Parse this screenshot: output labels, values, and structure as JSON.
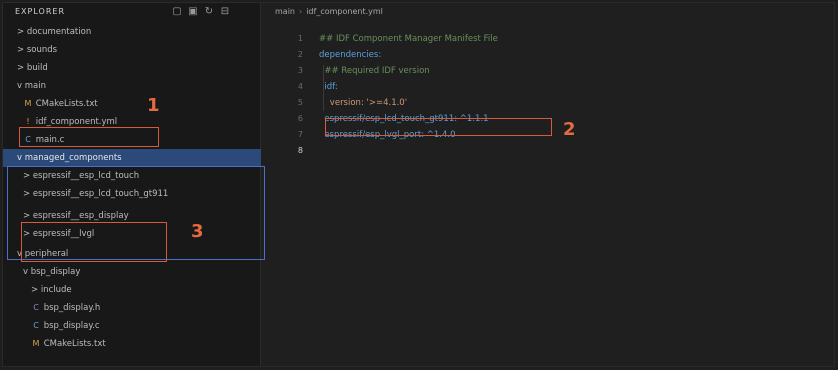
{
  "sidebar": {
    "title": "EXPLORER",
    "actions": [
      "new-file-icon",
      "new-folder-icon",
      "refresh-icon",
      "collapse-icon"
    ],
    "items": [
      {
        "label": "> documentation",
        "type": "folder"
      },
      {
        "label": "> sounds",
        "type": "folder"
      },
      {
        "label": "> build",
        "type": "folder"
      },
      {
        "label": "v main",
        "type": "folder"
      },
      {
        "label": "CMakeLists.txt",
        "type": "file"
      },
      {
        "label": "idf_component.yml",
        "type": "file"
      },
      {
        "label": "main.c",
        "type": "file"
      },
      {
        "label": "v managed_components",
        "type": "folder"
      },
      {
        "label": "> espressif__esp_lcd_touch",
        "type": "folder"
      },
      {
        "label": "> espressif__esp_lcd_touch_gt911",
        "type": "folder"
      },
      {
        "label": "> espressif__esp_display",
        "type": "folder"
      },
      {
        "label": "> espressif__lvgl",
        "type": "folder"
      },
      {
        "label": "v peripheral",
        "type": "folder"
      },
      {
        "label": "v bsp_display",
        "type": "folder"
      },
      {
        "label": "> include",
        "type": "folder"
      },
      {
        "label": "bsp_display.h",
        "type": "file"
      },
      {
        "label": "bsp_display.c",
        "type": "file"
      },
      {
        "label": "CMakeLists.txt",
        "type": "file"
      }
    ]
  },
  "editor": {
    "breadcrumb": [
      "main",
      "idf_component.yml"
    ],
    "line_numbers": [
      "1",
      "2",
      "3",
      "4",
      "5",
      "6",
      "7",
      "8"
    ],
    "lines": [
      "## IDF Component Manager Manifest File",
      "dependencies:",
      "  ## Required IDF version",
      "  idf:",
      "    version: '>=4.1.0'",
      "  espressif/esp_lcd_touch_gt911: ^1.1.1",
      "  espressif/esp_lvgl_port: ^1.4.0",
      ""
    ]
  },
  "annotations": [
    "1",
    "2",
    "3"
  ]
}
